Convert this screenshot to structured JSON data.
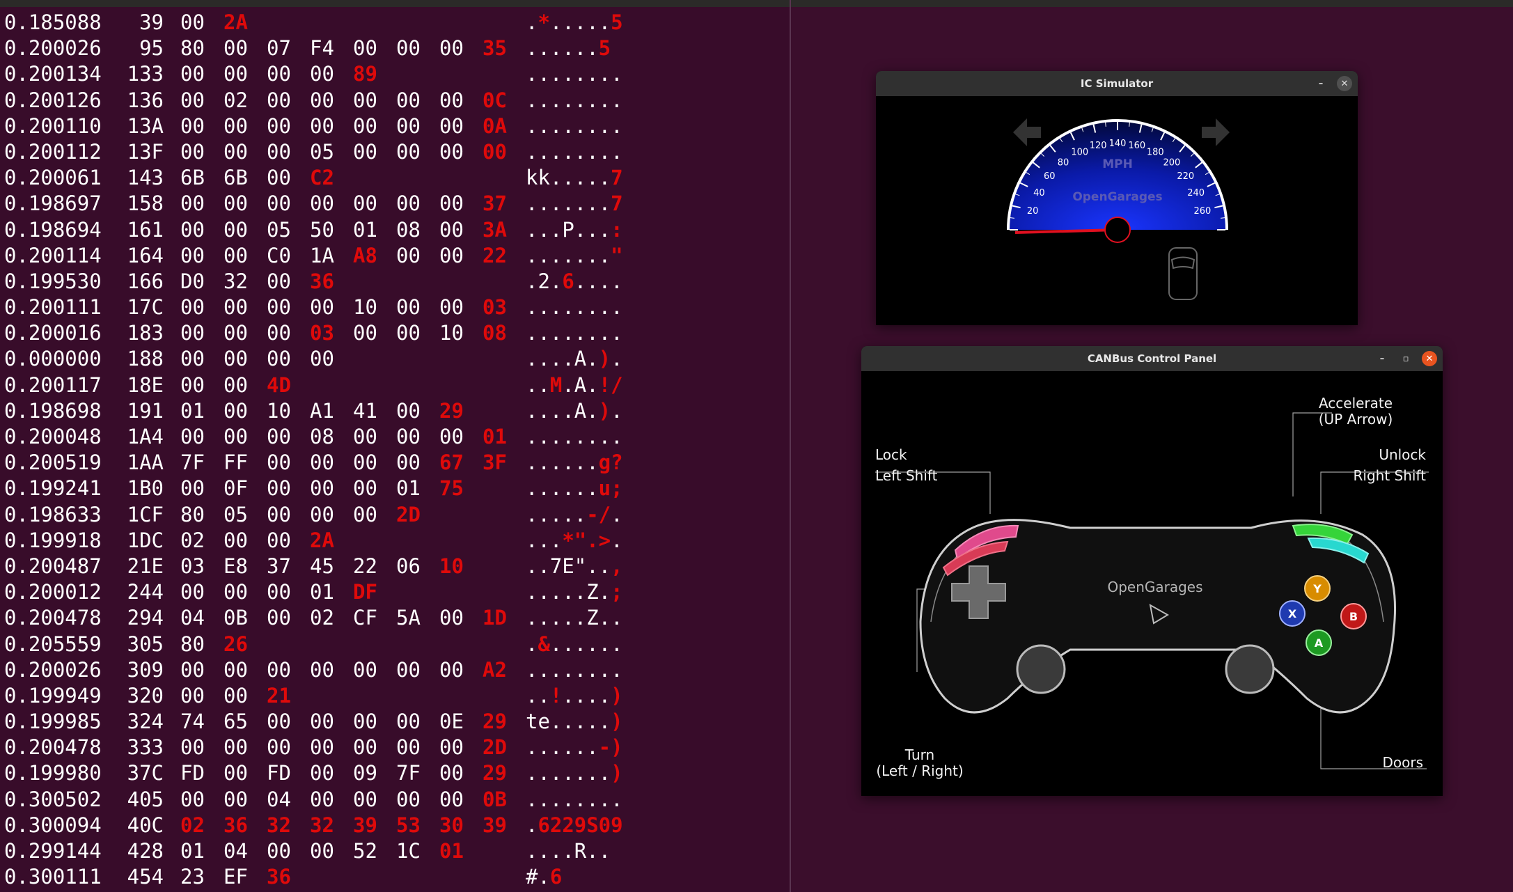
{
  "terminal": {
    "rows": [
      {
        "time": "0.185088",
        "id": "39",
        "bytes": [
          "00",
          "2A"
        ],
        "hot": [
          1
        ],
        "ascii": ".*.....5",
        "ahot": [
          1,
          7
        ]
      },
      {
        "time": "0.200026",
        "id": "95",
        "bytes": [
          "80",
          "00",
          "07",
          "F4",
          "00",
          "00",
          "00",
          "35"
        ],
        "hot": [
          7
        ],
        "ascii": "......5",
        "ahot": [
          6
        ]
      },
      {
        "time": "0.200134",
        "id": "133",
        "bytes": [
          "00",
          "00",
          "00",
          "00",
          "89"
        ],
        "hot": [
          4
        ],
        "ascii": "........",
        "ahot": []
      },
      {
        "time": "0.200126",
        "id": "136",
        "bytes": [
          "00",
          "02",
          "00",
          "00",
          "00",
          "00",
          "00",
          "0C"
        ],
        "hot": [
          7
        ],
        "ascii": "........",
        "ahot": []
      },
      {
        "time": "0.200110",
        "id": "13A",
        "bytes": [
          "00",
          "00",
          "00",
          "00",
          "00",
          "00",
          "00",
          "0A"
        ],
        "hot": [
          7
        ],
        "ascii": "........",
        "ahot": []
      },
      {
        "time": "0.200112",
        "id": "13F",
        "bytes": [
          "00",
          "00",
          "00",
          "05",
          "00",
          "00",
          "00",
          "00"
        ],
        "hot": [
          7
        ],
        "ascii": "........",
        "ahot": []
      },
      {
        "time": "0.200061",
        "id": "143",
        "bytes": [
          "6B",
          "6B",
          "00",
          "C2"
        ],
        "hot": [
          3
        ],
        "ascii": "kk.....7",
        "ahot": [
          7
        ]
      },
      {
        "time": "0.198697",
        "id": "158",
        "bytes": [
          "00",
          "00",
          "00",
          "00",
          "00",
          "00",
          "00",
          "37"
        ],
        "hot": [
          7
        ],
        "ascii": ".......7",
        "ahot": [
          7
        ]
      },
      {
        "time": "0.198694",
        "id": "161",
        "bytes": [
          "00",
          "00",
          "05",
          "50",
          "01",
          "08",
          "00",
          "3A"
        ],
        "hot": [
          7
        ],
        "ascii": "...P...:",
        "ahot": [
          7
        ]
      },
      {
        "time": "0.200114",
        "id": "164",
        "bytes": [
          "00",
          "00",
          "C0",
          "1A",
          "A8",
          "00",
          "00",
          "22"
        ],
        "hot": [
          4,
          7
        ],
        "ascii": ".......\"",
        "ahot": [
          7
        ]
      },
      {
        "time": "0.199530",
        "id": "166",
        "bytes": [
          "D0",
          "32",
          "00",
          "36"
        ],
        "hot": [
          3
        ],
        "ascii": ".2.6....",
        "ahot": [
          3
        ]
      },
      {
        "time": "0.200111",
        "id": "17C",
        "bytes": [
          "00",
          "00",
          "00",
          "00",
          "10",
          "00",
          "00",
          "03"
        ],
        "hot": [
          7
        ],
        "ascii": "........",
        "ahot": []
      },
      {
        "time": "0.200016",
        "id": "183",
        "bytes": [
          "00",
          "00",
          "00",
          "03",
          "00",
          "00",
          "10",
          "08"
        ],
        "hot": [
          3,
          7
        ],
        "ascii": "........",
        "ahot": []
      },
      {
        "time": "0.000000",
        "id": "188",
        "bytes": [
          "00",
          "00",
          "00",
          "00"
        ],
        "hot": [],
        "ascii": "....A.).",
        "ahot": [
          6
        ]
      },
      {
        "time": "0.200117",
        "id": "18E",
        "bytes": [
          "00",
          "00",
          "4D"
        ],
        "hot": [
          2
        ],
        "ascii": "..M.A.!/",
        "ahot": [
          2,
          6,
          7
        ]
      },
      {
        "time": "0.198698",
        "id": "191",
        "bytes": [
          "01",
          "00",
          "10",
          "A1",
          "41",
          "00",
          "29"
        ],
        "hot": [
          6
        ],
        "ascii": "....A.).",
        "ahot": [
          6
        ]
      },
      {
        "time": "0.200048",
        "id": "1A4",
        "bytes": [
          "00",
          "00",
          "00",
          "08",
          "00",
          "00",
          "00",
          "01"
        ],
        "hot": [
          7
        ],
        "ascii": "........",
        "ahot": []
      },
      {
        "time": "0.200519",
        "id": "1AA",
        "bytes": [
          "7F",
          "FF",
          "00",
          "00",
          "00",
          "00",
          "67",
          "3F"
        ],
        "hot": [
          6,
          7
        ],
        "ascii": "......g?",
        "ahot": [
          6,
          7
        ]
      },
      {
        "time": "0.199241",
        "id": "1B0",
        "bytes": [
          "00",
          "0F",
          "00",
          "00",
          "00",
          "01",
          "75"
        ],
        "hot": [
          6
        ],
        "ascii": "......u;",
        "ahot": [
          6,
          7
        ]
      },
      {
        "time": "0.198633",
        "id": "1CF",
        "bytes": [
          "80",
          "05",
          "00",
          "00",
          "00",
          "2D"
        ],
        "hot": [
          5
        ],
        "ascii": ".....-/.",
        "ahot": [
          5,
          6
        ]
      },
      {
        "time": "0.199918",
        "id": "1DC",
        "bytes": [
          "02",
          "00",
          "00",
          "2A"
        ],
        "hot": [
          3
        ],
        "ascii": "...*\".>.",
        "ahot": [
          3,
          4,
          5,
          6
        ]
      },
      {
        "time": "0.200487",
        "id": "21E",
        "bytes": [
          "03",
          "E8",
          "37",
          "45",
          "22",
          "06",
          "10"
        ],
        "hot": [
          6
        ],
        "ascii": "..7E\"..,",
        "ahot": [
          7
        ]
      },
      {
        "time": "0.200012",
        "id": "244",
        "bytes": [
          "00",
          "00",
          "00",
          "01",
          "DF"
        ],
        "hot": [
          4
        ],
        "ascii": ".....Z.;",
        "ahot": [
          7
        ]
      },
      {
        "time": "0.200478",
        "id": "294",
        "bytes": [
          "04",
          "0B",
          "00",
          "02",
          "CF",
          "5A",
          "00",
          "1D"
        ],
        "hot": [
          7
        ],
        "ascii": ".....Z..",
        "ahot": []
      },
      {
        "time": "0.205559",
        "id": "305",
        "bytes": [
          "80",
          "26"
        ],
        "hot": [
          1
        ],
        "ascii": ".&......",
        "ahot": [
          1
        ]
      },
      {
        "time": "0.200026",
        "id": "309",
        "bytes": [
          "00",
          "00",
          "00",
          "00",
          "00",
          "00",
          "00",
          "A2"
        ],
        "hot": [
          7
        ],
        "ascii": "........",
        "ahot": []
      },
      {
        "time": "0.199949",
        "id": "320",
        "bytes": [
          "00",
          "00",
          "21"
        ],
        "hot": [
          2
        ],
        "ascii": "..!....)",
        "ahot": [
          2,
          7
        ]
      },
      {
        "time": "0.199985",
        "id": "324",
        "bytes": [
          "74",
          "65",
          "00",
          "00",
          "00",
          "00",
          "0E",
          "29"
        ],
        "hot": [
          7
        ],
        "ascii": "te.....)",
        "ahot": [
          7
        ]
      },
      {
        "time": "0.200478",
        "id": "333",
        "bytes": [
          "00",
          "00",
          "00",
          "00",
          "00",
          "00",
          "00",
          "2D"
        ],
        "hot": [
          7
        ],
        "ascii": "......-)",
        "ahot": [
          6,
          7
        ]
      },
      {
        "time": "0.199980",
        "id": "37C",
        "bytes": [
          "FD",
          "00",
          "FD",
          "00",
          "09",
          "7F",
          "00",
          "29"
        ],
        "hot": [
          7
        ],
        "ascii": ".......)",
        "ahot": [
          7
        ]
      },
      {
        "time": "0.300502",
        "id": "405",
        "bytes": [
          "00",
          "00",
          "04",
          "00",
          "00",
          "00",
          "00",
          "0B"
        ],
        "hot": [
          7
        ],
        "ascii": "........",
        "ahot": []
      },
      {
        "time": "0.300094",
        "id": "40C",
        "bytes": [
          "02",
          "36",
          "32",
          "32",
          "39",
          "53",
          "30",
          "39"
        ],
        "hot": [
          0,
          1,
          2,
          3,
          4,
          5,
          6,
          7
        ],
        "ascii": ".6229S09",
        "ahot": [
          1,
          2,
          3,
          4,
          5,
          6,
          7
        ]
      },
      {
        "time": "0.299144",
        "id": "428",
        "bytes": [
          "01",
          "04",
          "00",
          "00",
          "52",
          "1C",
          "01"
        ],
        "hot": [
          6
        ],
        "ascii": "....R..",
        "ahot": []
      },
      {
        "time": "0.300111",
        "id": "454",
        "bytes": [
          "23",
          "EF",
          "36"
        ],
        "hot": [
          2
        ],
        "ascii": "#.6",
        "ahot": [
          2
        ]
      }
    ]
  },
  "ic_window": {
    "title": "IC Simulator",
    "speedometer": {
      "unit": "MPH",
      "brand": "OpenGarages",
      "ticks": [
        "20",
        "40",
        "60",
        "80",
        "100",
        "120",
        "140",
        "160",
        "180",
        "200",
        "220",
        "240",
        "260"
      ],
      "value_mph": 0
    }
  },
  "cp_window": {
    "title": "CANBus Control Panel",
    "brand": "OpenGarages",
    "labels": {
      "accelerate_l1": "Accelerate",
      "accelerate_l2": "(UP Arrow)",
      "lock_l1": "Lock",
      "lock_l2": "Left Shift",
      "unlock_l1": "Unlock",
      "unlock_l2": "Right Shift",
      "turn_l1": "Turn",
      "turn_l2": "(Left / Right)",
      "doors": "Doors"
    },
    "buttons": {
      "x": "X",
      "y": "Y",
      "a": "A",
      "b": "B"
    }
  },
  "colors": {
    "terminal_bg": "#380c2a",
    "highlight_red": "#df0a0a",
    "title_bar": "#303030",
    "close_orange": "#e95420",
    "gauge_blue": "#0a1fd6"
  }
}
